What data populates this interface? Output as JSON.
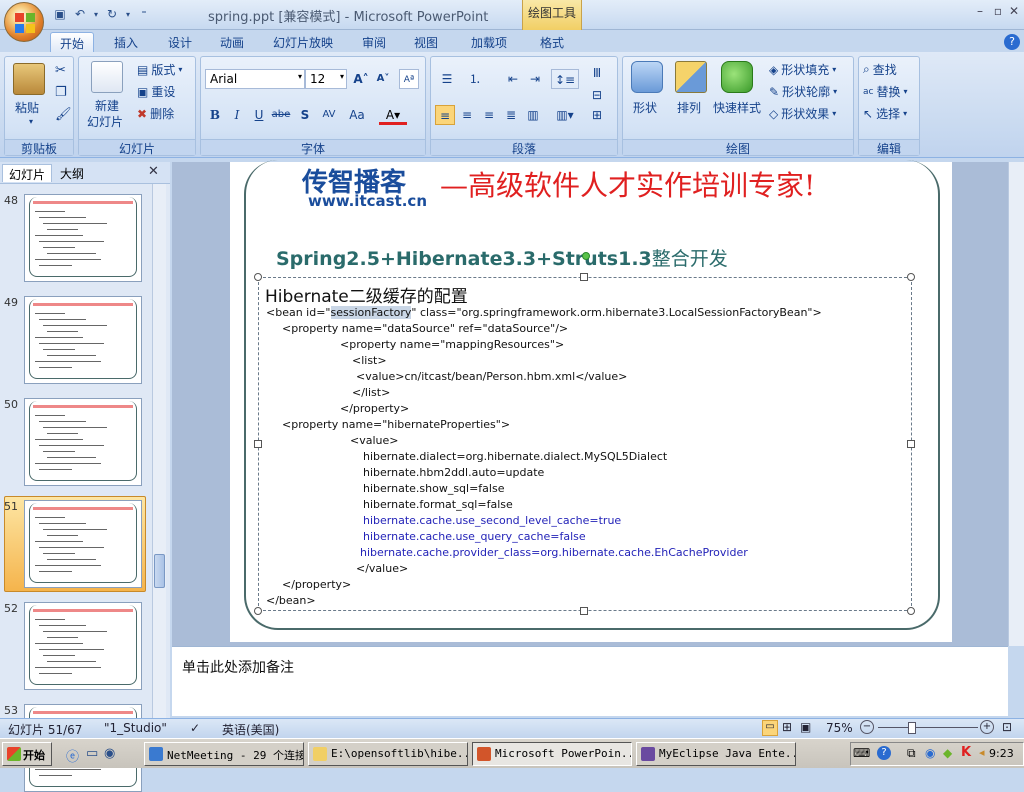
{
  "window": {
    "title": "spring.ppt [兼容模式] - Microsoft PowerPoint",
    "context_tab_title": "绘图工具",
    "controls": [
      "–",
      "▫",
      "✕"
    ],
    "ribbon_controls": [
      "–",
      "▫",
      "✕"
    ]
  },
  "tabs": [
    "开始",
    "插入",
    "设计",
    "动画",
    "幻灯片放映",
    "审阅",
    "视图",
    "加载项",
    "格式"
  ],
  "ribbon": {
    "clipboard": {
      "label": "剪贴板",
      "paste": "粘贴"
    },
    "slides": {
      "label": "幻灯片",
      "new_slide_line1": "新建",
      "new_slide_line2": "幻灯片",
      "layout": "版式",
      "reset": "重设",
      "delete": "删除"
    },
    "font": {
      "label": "字体",
      "font_name": "Arial",
      "font_size": "12"
    },
    "paragraph": {
      "label": "段落"
    },
    "drawing": {
      "label": "绘图",
      "shapes": "形状",
      "arrange": "排列",
      "quick_styles": "快速样式",
      "shape_fill": "形状填充",
      "shape_outline": "形状轮廓",
      "shape_effects": "形状效果"
    },
    "editing": {
      "label": "编辑",
      "find": "查找",
      "replace": "替换",
      "select": "选择"
    }
  },
  "left_pane": {
    "tabs": [
      "幻灯片",
      "大纲"
    ],
    "close": "✕",
    "slide_numbers": [
      "48",
      "49",
      "50",
      "51",
      "52",
      "53"
    ],
    "selected_index": 3
  },
  "slide": {
    "logo_text": "传智播客",
    "logo_url": "www.itcast.cn",
    "slogan": "—高级软件人才实作培训专家!",
    "subtitle_en": "Spring2.5+Hibernate3.3+Struts1.3",
    "subtitle_cn": "整合开发",
    "heading": "Hibernate二级缓存的配置",
    "code_lines": [
      {
        "pre": "<bean id=\"",
        "hl": "sessionFactory",
        "post": "\" class=\"org.springframework.orm.hibernate3.LocalSessionFactoryBean\">"
      },
      {
        "text": "<property name=\"dataSource\" ref=\"dataSource\"/>"
      },
      {
        "text": "<property name=\"mappingResources\">"
      },
      {
        "text": "<list>"
      },
      {
        "text": "<value>cn/itcast/bean/Person.hbm.xml</value>"
      },
      {
        "text": "</list>"
      },
      {
        "text": "</property>"
      },
      {
        "text": "<property name=\"hibernateProperties\">"
      },
      {
        "text": "<value>"
      },
      {
        "text": "hibernate.dialect=org.hibernate.dialect.MySQL5Dialect"
      },
      {
        "text": "hibernate.hbm2ddl.auto=update"
      },
      {
        "text": "hibernate.show_sql=false"
      },
      {
        "text": "hibernate.format_sql=false"
      },
      {
        "text": "hibernate.cache.use_second_level_cache=true"
      },
      {
        "text": "hibernate.cache.use_query_cache=false"
      },
      {
        "text": "hibernate.cache.provider_class=org.hibernate.cache.EhCacheProvider"
      },
      {
        "text": "</value>"
      },
      {
        "text": "</property>"
      },
      {
        "text": "</bean>"
      }
    ]
  },
  "notes_placeholder": "单击此处添加备注",
  "status": {
    "slide_of": "幻灯片 51/67",
    "theme": "\"1_Studio\"",
    "language": "英语(美国)",
    "zoom": "75%"
  },
  "taskbar": {
    "start": "开始",
    "items": [
      "NetMeeting - 29 个连接",
      "E:\\opensoftlib\\hibe...",
      "Microsoft PowerPoin...",
      "MyEclipse Java Ente..."
    ],
    "clock": "9:23"
  },
  "colors": {
    "logo_blue": "#1a4d9c",
    "logo_red": "#e02020",
    "subtitle": "#2a6b6b",
    "code_blue": "#2323b8",
    "selected_thumb": "#f5b44c"
  }
}
